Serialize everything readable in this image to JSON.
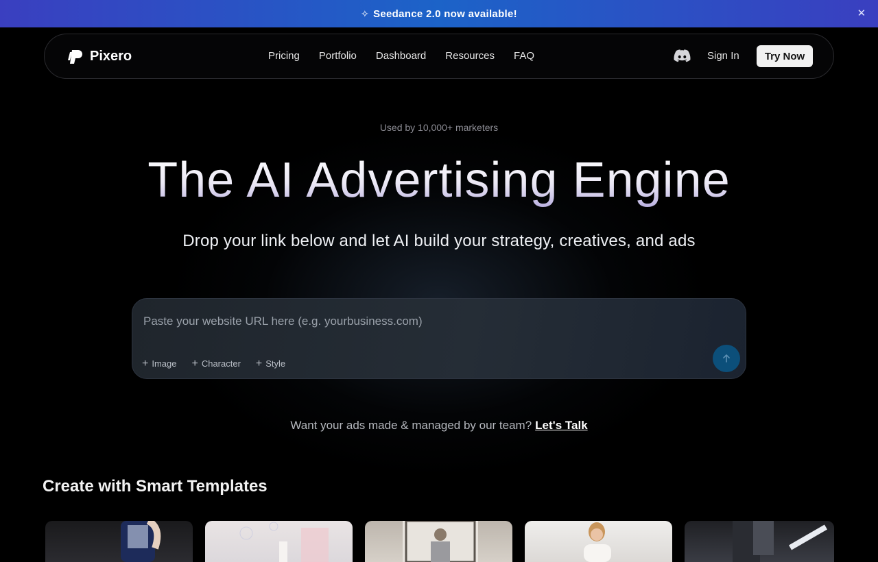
{
  "banner": {
    "spark_icon": "sparkle-icon",
    "text": "Seedance 2.0 now available!",
    "close_icon": "close-icon"
  },
  "nav": {
    "brand": "Pixero",
    "links": [
      "Pricing",
      "Portfolio",
      "Dashboard",
      "Resources",
      "FAQ"
    ],
    "discord_icon": "discord-icon",
    "sign_in": "Sign In",
    "try_now": "Try Now"
  },
  "hero": {
    "kicker": "Used by 10,000+ marketers",
    "headline": "The AI Advertising Engine",
    "subheadline": "Drop your link below and let AI build your strategy, creatives, and ads"
  },
  "prompt": {
    "placeholder": "Paste your website URL here (e.g. yourbusiness.com)",
    "value": "",
    "chips": [
      "Image",
      "Character",
      "Style"
    ],
    "send_icon": "arrow-up-icon"
  },
  "cta": {
    "text": "Want your ads made & managed by our team?",
    "link": "Let's Talk"
  },
  "templates": {
    "title": "Create with Smart Templates"
  },
  "colors": {
    "banner_start": "#3a3fc0",
    "banner_mid": "#1c63c8",
    "send_button": "#0c4f7a",
    "background": "#000000"
  }
}
